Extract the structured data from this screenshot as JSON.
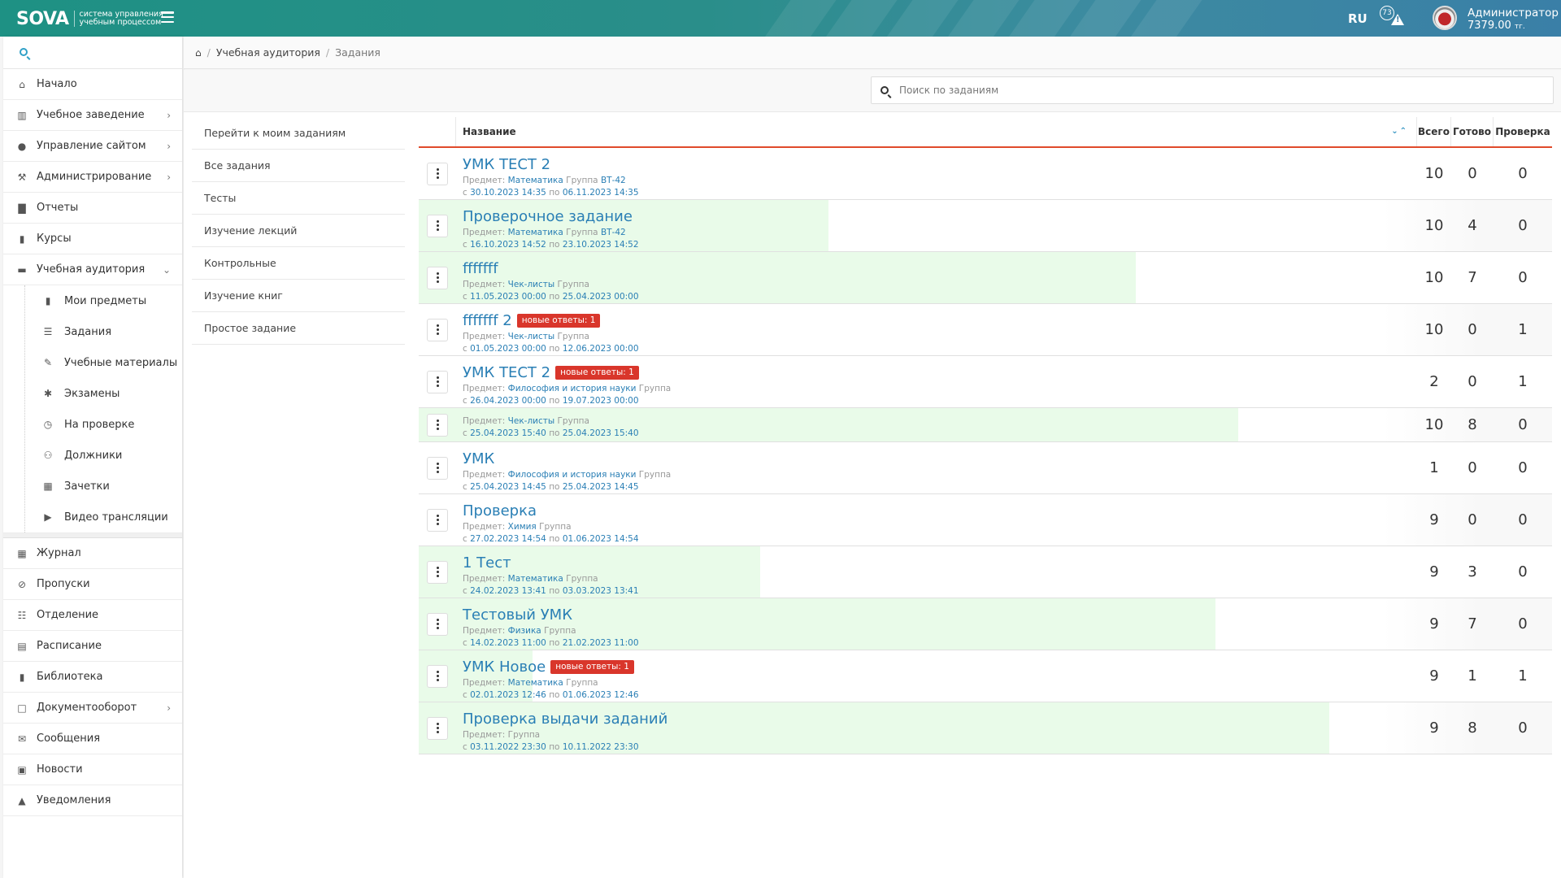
{
  "header": {
    "brand": "SOVA",
    "tagline": "система управления учебным процессом",
    "lang": "RU",
    "alerts_count": "73",
    "user_name": "Администратор",
    "balance": "7379.00",
    "currency": "тг."
  },
  "sidebar": {
    "top_items": [
      {
        "label": "Начало",
        "icon": "home-icon"
      },
      {
        "label": "Учебное заведение",
        "icon": "building-icon",
        "chevron": true
      },
      {
        "label": "Управление сайтом",
        "icon": "globe-icon",
        "chevron": true
      },
      {
        "label": "Администрирование",
        "icon": "gavel-icon",
        "chevron": true
      },
      {
        "label": "Отчеты",
        "icon": "chart-icon"
      },
      {
        "label": "Курсы",
        "icon": "book-icon"
      },
      {
        "label": "Учебная аудитория",
        "icon": "monitor-icon",
        "chevron": true,
        "expanded": true
      }
    ],
    "sub_items": [
      {
        "label": "Мои предметы",
        "icon": "book-icon"
      },
      {
        "label": "Задания",
        "icon": "tasks-icon"
      },
      {
        "label": "Учебные материалы",
        "icon": "pencil-icon"
      },
      {
        "label": "Экзамены",
        "icon": "asterisk-icon"
      },
      {
        "label": "На проверке",
        "icon": "clock-icon"
      },
      {
        "label": "Должники",
        "icon": "users-icon"
      },
      {
        "label": "Зачетки",
        "icon": "table-icon"
      },
      {
        "label": "Видео трансляции",
        "icon": "video-icon"
      }
    ],
    "bottom_items": [
      {
        "label": "Журнал",
        "icon": "table-icon"
      },
      {
        "label": "Пропуски",
        "icon": "ban-icon"
      },
      {
        "label": "Отделение",
        "icon": "sitemap-icon"
      },
      {
        "label": "Расписание",
        "icon": "schedule-icon"
      },
      {
        "label": "Библиотека",
        "icon": "book-icon"
      },
      {
        "label": "Документооборот",
        "icon": "document-icon",
        "chevron": true
      },
      {
        "label": "Сообщения",
        "icon": "envelope-icon"
      },
      {
        "label": "Новости",
        "icon": "news-icon"
      },
      {
        "label": "Уведомления",
        "icon": "warning-icon"
      }
    ]
  },
  "breadcrumb": {
    "items": [
      "Учебная аудитория",
      "Задания"
    ]
  },
  "search": {
    "placeholder": "Поиск по заданиям",
    "value": ""
  },
  "filters": [
    "Перейти к моим заданиям",
    "Все задания",
    "Тесты",
    "Изучение лекций",
    "Контрольные",
    "Изучение книг",
    "Простое задание"
  ],
  "table": {
    "headers": {
      "name": "Название",
      "total": "Всего",
      "ready": "Готово",
      "check": "Проверка"
    },
    "labels": {
      "subject": "Предмет:",
      "group": "Группа",
      "from": "с",
      "to": "по"
    },
    "rows": [
      {
        "title": "УМК ТЕСТ 2",
        "badge": "",
        "subject": "Математика",
        "group": "ВТ-42",
        "from": "30.10.2023 14:35",
        "to": "06.11.2023 14:35",
        "total": "10",
        "ready": "0",
        "check": "0",
        "progress": 0
      },
      {
        "title": "Проверочное задание",
        "badge": "",
        "subject": "Математика",
        "group": "ВТ-42",
        "from": "16.10.2023 14:52",
        "to": "23.10.2023 14:52",
        "total": "10",
        "ready": "4",
        "check": "0",
        "progress": 0.4
      },
      {
        "title": "fffffff",
        "badge": "",
        "subject": "Чек-листы",
        "group": "",
        "from": "11.05.2023 00:00",
        "to": "25.04.2023 00:00",
        "total": "10",
        "ready": "7",
        "check": "0",
        "progress": 0.7
      },
      {
        "title": "fffffff 2",
        "badge": "новые ответы: 1",
        "subject": "Чек-листы",
        "group": "",
        "from": "01.05.2023 00:00",
        "to": "12.06.2023 00:00",
        "total": "10",
        "ready": "0",
        "check": "1",
        "progress": 0
      },
      {
        "title": "УМК ТЕСТ 2",
        "badge": "новые ответы: 1",
        "subject": "Философия и история науки",
        "group": "",
        "from": "26.04.2023 00:00",
        "to": "19.07.2023 00:00",
        "total": "2",
        "ready": "0",
        "check": "1",
        "progress": 0
      },
      {
        "title": "",
        "badge": "",
        "subject": "Чек-листы",
        "group": "",
        "from": "25.04.2023 15:40",
        "to": "25.04.2023 15:40",
        "total": "10",
        "ready": "8",
        "check": "0",
        "progress": 0.8
      },
      {
        "title": "УМК",
        "badge": "",
        "subject": "Философия и история науки",
        "group": "",
        "from": "25.04.2023 14:45",
        "to": "25.04.2023 14:45",
        "total": "1",
        "ready": "0",
        "check": "0",
        "progress": 0
      },
      {
        "title": "Проверка",
        "badge": "",
        "subject": "Химия",
        "group": "",
        "from": "27.02.2023 14:54",
        "to": "01.06.2023 14:54",
        "total": "9",
        "ready": "0",
        "check": "0",
        "progress": 0
      },
      {
        "title": "1 Тест",
        "badge": "",
        "subject": "Математика",
        "group": "",
        "from": "24.02.2023 13:41",
        "to": "03.03.2023 13:41",
        "total": "9",
        "ready": "3",
        "check": "0",
        "progress": 0.333
      },
      {
        "title": "Тестовый УМК",
        "badge": "",
        "subject": "Физика",
        "group": "",
        "from": "14.02.2023 11:00",
        "to": "21.02.2023 11:00",
        "total": "9",
        "ready": "7",
        "check": "0",
        "progress": 0.778
      },
      {
        "title": "УМК Новое",
        "badge": "новые ответы: 1",
        "subject": "Математика",
        "group": "",
        "from": "02.01.2023 12:46",
        "to": "01.06.2023 12:46",
        "total": "9",
        "ready": "1",
        "check": "1",
        "progress": 0.111
      },
      {
        "title": "Проверка выдачи заданий",
        "badge": "",
        "subject": "",
        "group": "",
        "from": "03.11.2022 23:30",
        "to": "10.11.2022 23:30",
        "total": "9",
        "ready": "8",
        "check": "0",
        "progress": 0.889
      }
    ]
  }
}
